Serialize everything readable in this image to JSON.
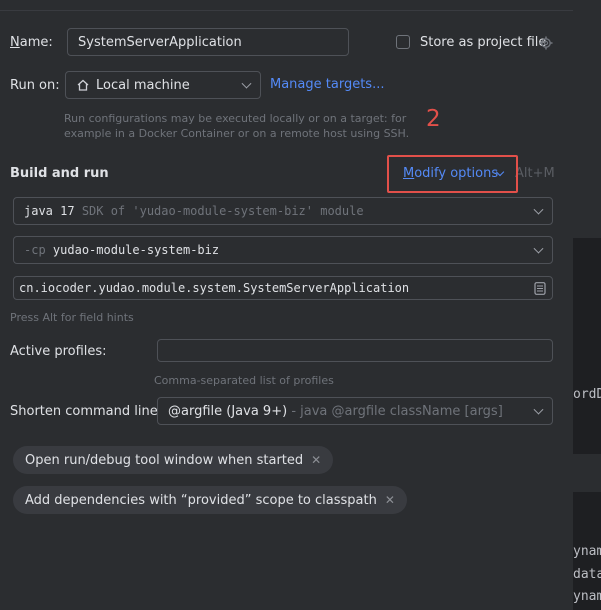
{
  "form": {
    "name_label": "Name:",
    "name_value": "SystemServerApplication",
    "store_label": "Store as project file",
    "run_on_label": "Run on:",
    "run_on_value": "Local machine",
    "manage_targets": "Manage targets...",
    "run_on_hint_1": "Run configurations may be executed locally or on a target: for",
    "run_on_hint_2": "example in a Docker Container or on a remote host using SSH.",
    "annotation_number": "2"
  },
  "build": {
    "heading": "Build and run",
    "modify_options": "Modify options",
    "shortcut": "Alt+M",
    "jdk_main": "java 17",
    "jdk_sub": "SDK of 'yudao-module-system-biz' module",
    "cp_prefix": "-cp",
    "cp_value": "yudao-module-system-biz",
    "main_class": "cn.iocoder.yudao.module.system.SystemServerApplication",
    "field_hint": "Press Alt for field hints"
  },
  "profiles": {
    "label": "Active profiles:",
    "value": "",
    "hint": "Comma-separated list of profiles"
  },
  "shorten": {
    "label": "Shorten command line:",
    "value_main": "@argfile (Java 9+)",
    "value_sub": "- java @argfile className [args]"
  },
  "tags": [
    {
      "label": "Open run/debug tool window when started"
    },
    {
      "label": "Add dependencies with “provided” scope to classpath"
    }
  ],
  "background_editor": {
    "line_1": "ordDO",
    "line_2": "ynam",
    "line_3": "data",
    "line_4": "ynam"
  },
  "colors": {
    "accent": "#548af7",
    "annotation": "#e2504a",
    "background": "#2b2d30"
  }
}
